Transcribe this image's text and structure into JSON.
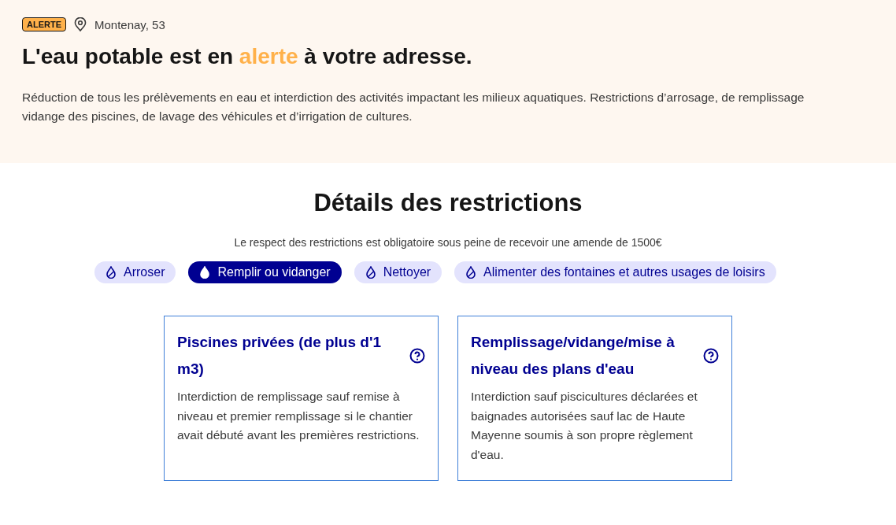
{
  "alert": {
    "badge": "ALERTE",
    "location": "Montenay, 53",
    "title": "L'eau potable est en **alerte** à votre adresse.",
    "description_lines": [
      "Réduction de tous les prélèvements en eau et interdiction des activités impactant les milieux aquatiques. Restrictions d’arrosage, de remplissage",
      "vidange des piscines, de lavage des véhicules et d’irrigation de cultures."
    ]
  },
  "details": {
    "title": "Détails des restrictions",
    "notice": "Le respect des restrictions est obligatoire sous peine de recevoir une amende de 1500€",
    "tabs": [
      {
        "label": "Arroser",
        "selected": false
      },
      {
        "label": "Remplir ou vidanger",
        "selected": true
      },
      {
        "label": "Nettoyer",
        "selected": false
      },
      {
        "label": "Alimenter des fontaines et autres usages de loisirs",
        "selected": false
      }
    ],
    "cards": [
      {
        "title": "Piscines privées (de plus d'1 m3)",
        "text": "Interdiction de remplissage sauf remise à niveau et premier remplissage si le chantier avait débuté avant les premières restrictions."
      },
      {
        "title": "Remplissage/vidange/mise à niveau des plans d'eau",
        "text": "Interdiction sauf piscicultures déclarées et baignades autorisées sauf lac de Haute Mayenne soumis à son propre règlement d'eau."
      }
    ]
  }
}
